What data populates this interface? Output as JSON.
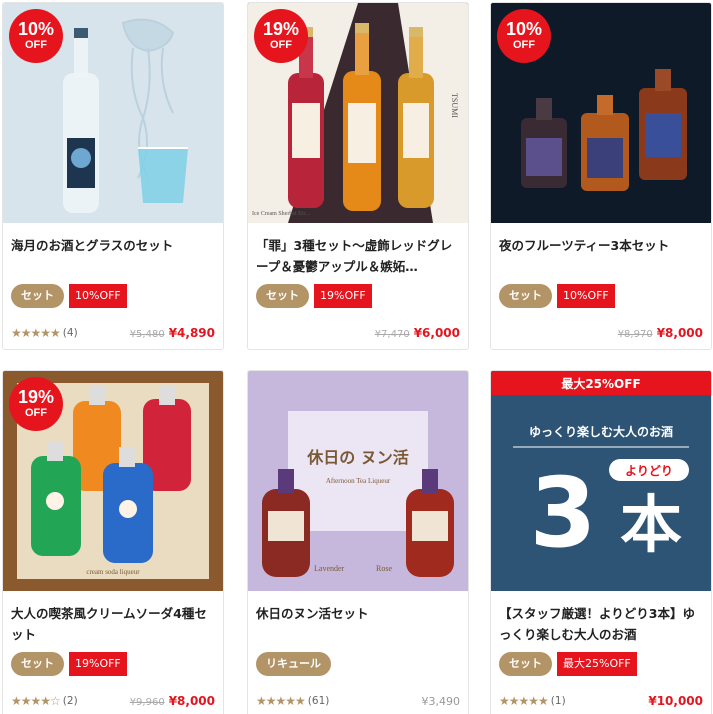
{
  "products": [
    {
      "title": "海月のお酒とグラスのセット",
      "badge_pct": "10%",
      "badge_off": "OFF",
      "tag_type": "セット",
      "tag_discount": "10%OFF",
      "stars": "★★★★★",
      "reviews": "(4)",
      "old_price": "¥5,480",
      "price": "¥4,890"
    },
    {
      "title": "「罪」3種セット〜虚飾レッドグレープ＆憂鬱アップル＆嫉妬…",
      "badge_pct": "19%",
      "badge_off": "OFF",
      "tag_type": "セット",
      "tag_discount": "19%OFF",
      "old_price": "¥7,470",
      "price": "¥6,000",
      "image_text": {
        "side": "TSUMI",
        "label": "Ice Cream Sherbet Etc..."
      }
    },
    {
      "title": "夜のフルーツティー3本セット",
      "badge_pct": "10%",
      "badge_off": "OFF",
      "tag_type": "セット",
      "tag_discount": "10%OFF",
      "old_price": "¥8,970",
      "price": "¥8,000"
    },
    {
      "title": "大人の喫茶風クリームソーダ4種セット",
      "badge_pct": "19%",
      "badge_off": "OFF",
      "tag_type": "セット",
      "tag_discount": "19%OFF",
      "stars": "★★★★☆",
      "reviews": "(2)",
      "old_price": "¥9,960",
      "price": "¥8,000",
      "image_text": {
        "footer": "cream soda liqueur"
      }
    },
    {
      "title": "休日のヌン活セット",
      "tag_type": "リキュール",
      "stars": "★★★★★",
      "reviews": "(61)",
      "price": "¥3,490",
      "image_text": {
        "heading": "休日の ヌン活",
        "sub": "Afternoon Tea Liqueur",
        "left": "Lavender",
        "right": "Rose"
      }
    },
    {
      "title": "【スタッフ厳選！よりどり3本】ゆっくり楽しむ大人のお酒",
      "tag_type": "セット",
      "tag_discount": "最大25%OFF",
      "stars": "★★★★★",
      "reviews": "(1)",
      "price": "¥10,000",
      "image_text": {
        "banner": "最大25%OFF",
        "head": "ゆっくり楽しむ大人のお酒",
        "big_num": "3",
        "big_kanji": "本",
        "pick": "よりどり"
      }
    }
  ],
  "colors": {
    "accent_red": "#e5141d",
    "gold": "#b39467",
    "star": "#b39467"
  }
}
